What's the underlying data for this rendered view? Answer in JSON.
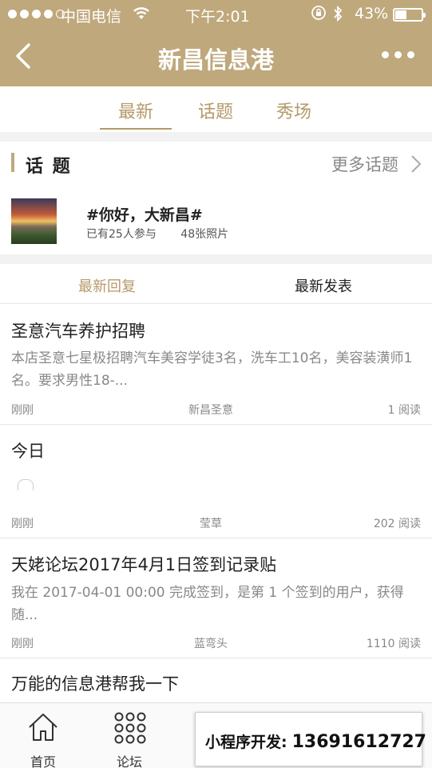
{
  "status_bar": {
    "carrier": "中国电信",
    "time": "下午2:01",
    "battery": "43%",
    "battery_level": 0.43
  },
  "nav": {
    "title": "新昌信息港",
    "back_icon": "chevron-left-icon",
    "more_icon": "more-dots-icon"
  },
  "tabs": [
    {
      "label": "最新",
      "active": true
    },
    {
      "label": "话题",
      "active": false
    },
    {
      "label": "秀场",
      "active": false
    }
  ],
  "topics": {
    "heading": "话 题",
    "more_label": "更多话题",
    "card": {
      "name": "#你好，大新昌#",
      "participants": "已有25人参与",
      "photos": "48张照片"
    }
  },
  "subtabs": [
    {
      "label": "最新回复",
      "active": true
    },
    {
      "label": "最新发表",
      "active": false
    }
  ],
  "posts": [
    {
      "title": "圣意汽车养护招聘",
      "excerpt": "本店圣意七星极招聘汽车美容学徒3名，洗车工10名，美容装潢师1名。要求男性18-...",
      "time": "刚刚",
      "author": "新昌圣意",
      "views": "1 阅读"
    },
    {
      "title": "今日",
      "excerpt": "",
      "time": "刚刚",
      "author": "莹草",
      "views": "202 阅读"
    },
    {
      "title": "天姥论坛2017年4月1日签到记录贴",
      "excerpt": "我在 2017-04-01 00:00 完成签到，是第 1 个签到的用户，获得随...",
      "time": "刚刚",
      "author": "蓝弯头",
      "views": "1110 阅读"
    },
    {
      "title": "万能的信息港帮我一下"
    }
  ],
  "bottom_nav": [
    {
      "label": "首页",
      "icon": "home-icon"
    },
    {
      "label": "论坛",
      "icon": "grid-icon"
    }
  ],
  "ad": {
    "label": "小程序开发:",
    "phone": "13691612727"
  },
  "colors": {
    "brand": "#bfa87c",
    "accent_text": "#b59a6a"
  }
}
